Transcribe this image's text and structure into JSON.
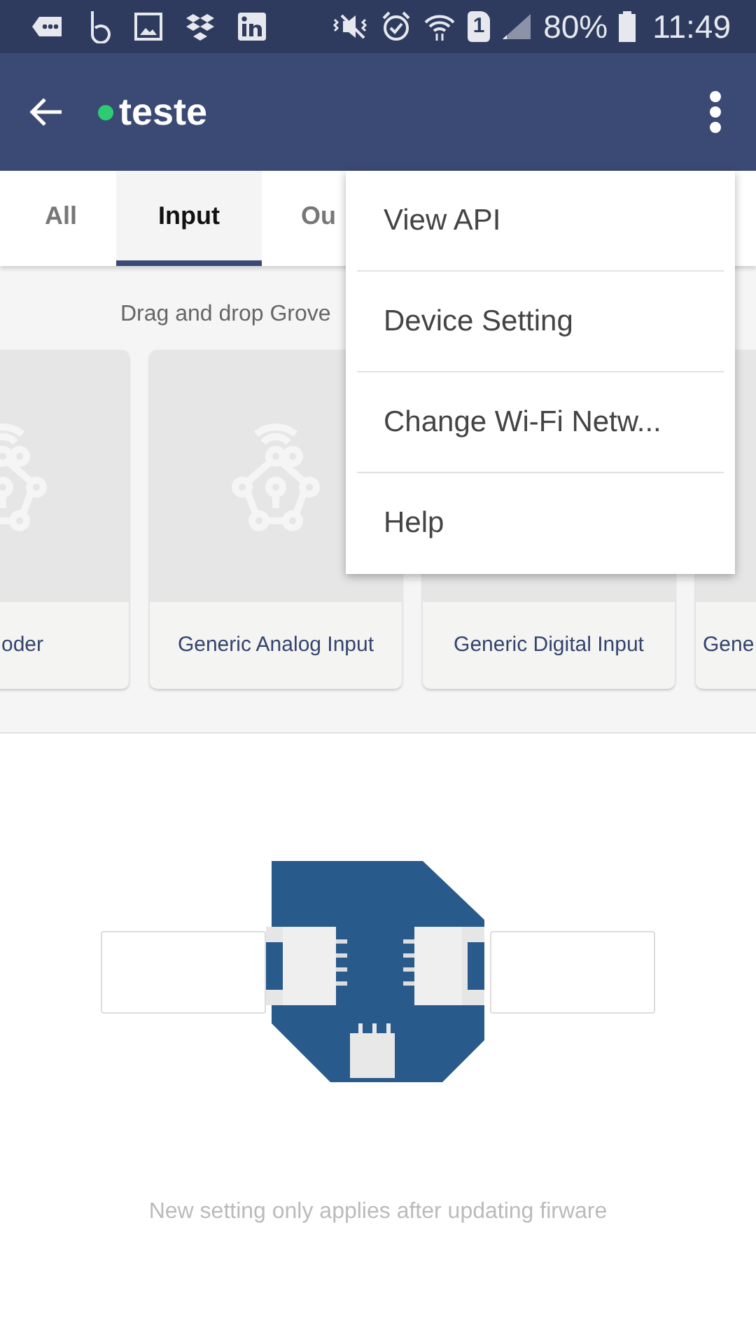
{
  "status_bar": {
    "sim_slot": "1",
    "battery": "80%",
    "time": "11:49"
  },
  "app_bar": {
    "title": "teste",
    "online": true
  },
  "tabs": [
    {
      "label": "All",
      "selected": false
    },
    {
      "label": "Input",
      "selected": true
    },
    {
      "label": "Ou",
      "selected": false
    }
  ],
  "hint": "Drag and drop Grove",
  "cards": [
    {
      "label": "oder",
      "icon": true
    },
    {
      "label": "Generic Analog Input",
      "icon": true
    },
    {
      "label": "Generic Digital Input"
    },
    {
      "label": "Gene"
    }
  ],
  "menu": [
    {
      "label": "View API"
    },
    {
      "label": "Device Setting"
    },
    {
      "label": "Change Wi-Fi Netw..."
    },
    {
      "label": "Help"
    }
  ],
  "note": "New setting only applies after updating firware"
}
